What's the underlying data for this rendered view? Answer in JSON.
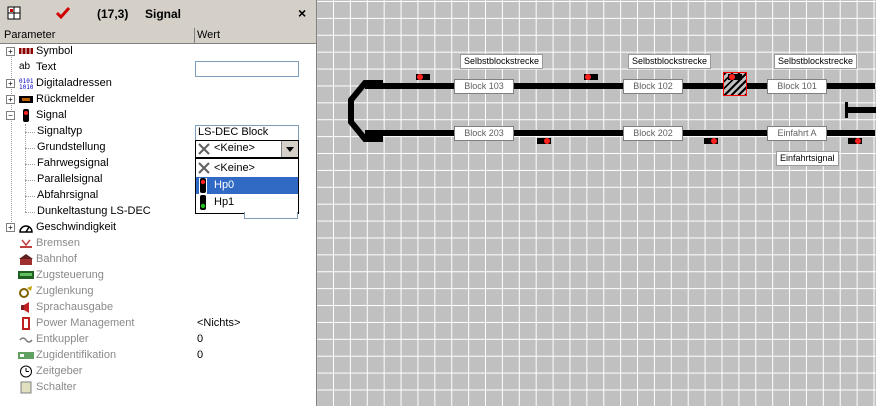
{
  "title_bar": {
    "coords": "(17,3)",
    "title": "Signal",
    "close": "×"
  },
  "columns": {
    "param": "Parameter",
    "value": "Wert"
  },
  "tree": [
    {
      "label": "Symbol",
      "value": ""
    },
    {
      "label": "Text",
      "value": ""
    },
    {
      "label": "Digitaladressen",
      "value": ""
    },
    {
      "label": "Rückmelder",
      "value": ""
    },
    {
      "label": "Signal",
      "value": ""
    },
    {
      "label": "Signaltyp",
      "value": "LS-DEC Block"
    },
    {
      "label": "Grundstellung",
      "value": "<Keine>"
    },
    {
      "label": "Fahrwegsignal",
      "value": ""
    },
    {
      "label": "Parallelsignal",
      "value": ""
    },
    {
      "label": "Abfahrsignal",
      "value": ""
    },
    {
      "label": "Dunkeltastung LS-DEC",
      "value": ""
    },
    {
      "label": "Geschwindigkeit",
      "value": ""
    },
    {
      "label": "Bremsen",
      "value": ""
    },
    {
      "label": "Bahnhof",
      "value": ""
    },
    {
      "label": "Zugsteuerung",
      "value": ""
    },
    {
      "label": "Zuglenkung",
      "value": ""
    },
    {
      "label": "Sprachausgabe",
      "value": ""
    },
    {
      "label": "Power Management",
      "value": "<Nichts>"
    },
    {
      "label": "Entkuppler",
      "value": "0"
    },
    {
      "label": "Zugidentifikation",
      "value": "0"
    },
    {
      "label": "Zeitgeber",
      "value": ""
    },
    {
      "label": "Schalter",
      "value": ""
    }
  ],
  "dropdown": {
    "options": [
      "<Keine>",
      "Hp0",
      "Hp1"
    ],
    "selected": "Hp0"
  },
  "layout": {
    "blocks_top": [
      "Block 103",
      "Block 102",
      "Block 101"
    ],
    "blocks_bottom": [
      "Block 203",
      "Block 202",
      "Einfahrt A"
    ],
    "labels_top": [
      "Selbstblockstrecke",
      "Selbstblockstrecke",
      "Selbstblockstrecke"
    ],
    "label_bottom": "Einfahrtsignal"
  },
  "colors": {
    "selection": "#316ac5",
    "signal_red": "#ff2020",
    "signal_green": "#20c020",
    "highlight": "#ff0000"
  }
}
